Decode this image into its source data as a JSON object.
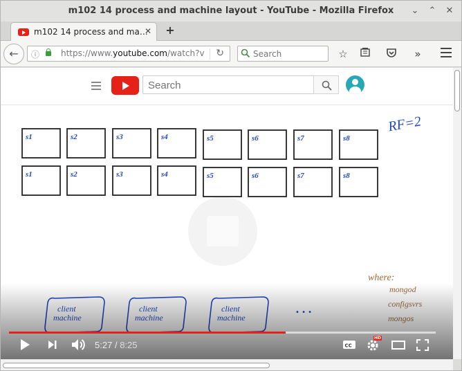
{
  "window": {
    "title": "m102 14 process and machine layout - YouTube - Mozilla Firefox",
    "minimize": "⌄",
    "maximize": "⌃",
    "close": "✕"
  },
  "tabs": [
    {
      "label": "m102 14 process and ma…",
      "close": "✕"
    }
  ],
  "newtab_label": "+",
  "navbar": {
    "url_prefix": "https://www.",
    "url_host": "youtube.com",
    "url_path": "/watch?v",
    "search_placeholder": "Search"
  },
  "youtube": {
    "search_placeholder": "Search"
  },
  "whiteboard": {
    "rf_note": "RF=2",
    "row1": [
      "s1",
      "s2",
      "s3",
      "s4",
      "s5",
      "s6",
      "s7",
      "s8"
    ],
    "row2": [
      "s1",
      "s2",
      "s3",
      "s4",
      "s5",
      "s6",
      "s7",
      "s8"
    ],
    "clients": [
      "client machine",
      "client machine",
      "client machine"
    ],
    "ellipsis": "• • •",
    "where_title": "where:",
    "where_items": [
      "mongod",
      "configsvrs",
      "mongos"
    ]
  },
  "player": {
    "current_time": "5:27",
    "separator": "/",
    "duration": "8:25",
    "progress_fraction": 0.648,
    "hd_badge": "HD",
    "cc_label": "CC"
  },
  "colors": {
    "accent": "#e62117",
    "ink_blue": "#1f47c4",
    "ink_brown": "#9a6a3a"
  }
}
